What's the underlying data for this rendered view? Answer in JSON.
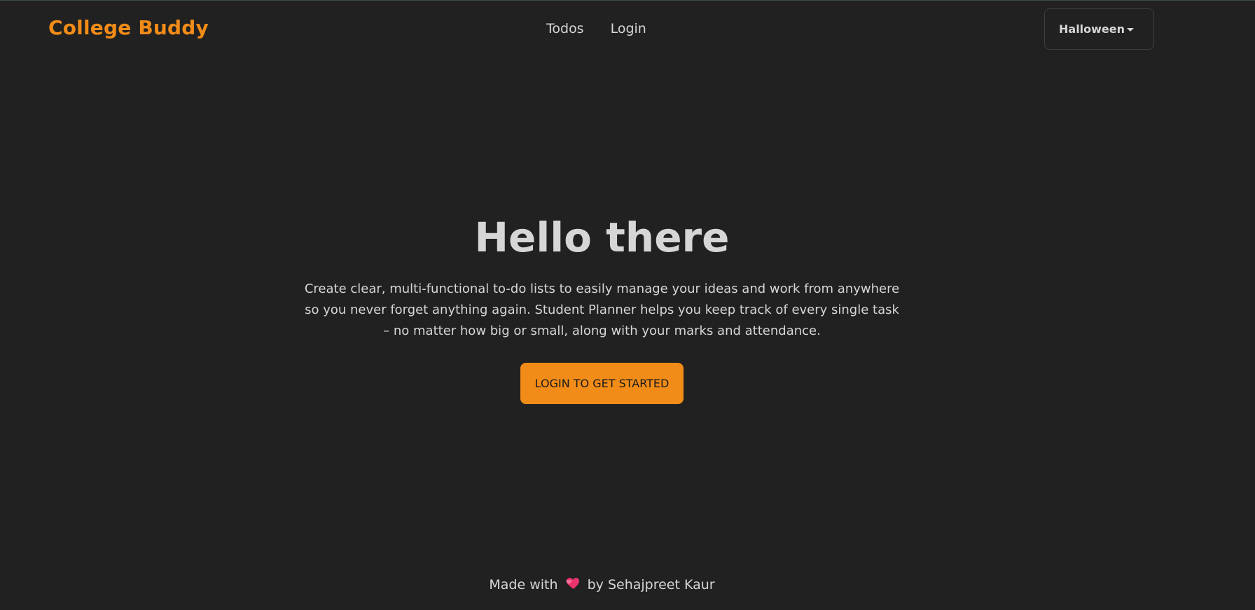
{
  "navbar": {
    "brand": "College Buddy",
    "links": [
      "Todos",
      "Login"
    ],
    "theme_select": {
      "selected": "Halloween",
      "icon": "chevron-down-icon"
    }
  },
  "hero": {
    "title": "Hello there",
    "description": "Create clear, multi-functional to-do lists to easily manage your ideas and work from anywhere so you never forget anything again. Student Planner helps you keep track of every single task – no matter how big or small, along with your marks and attendance.",
    "cta_label": "LOGIN TO GET STARTED"
  },
  "footer": {
    "prefix": "Made with",
    "icon": "heart-icon",
    "suffix": "by Sehajpreet Kaur"
  },
  "colors": {
    "background": "#212121",
    "accent": "#f28c18",
    "text": "#d6d6d6",
    "heart": "#e8336d"
  }
}
